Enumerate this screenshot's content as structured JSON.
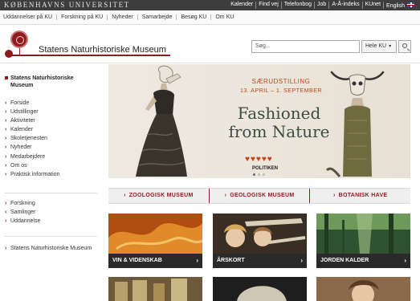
{
  "topbar": {
    "brand": "KØBENHAVNS UNIVERSITET",
    "links": [
      "Kalender",
      "Find vej",
      "Telefonbog",
      "Job",
      "A-Å-indeks",
      "KUnet",
      "English"
    ]
  },
  "subnav": {
    "items": [
      "Uddannelser på KU",
      "Forskning på KU",
      "Nyheder",
      "Samarbejde",
      "Besøg KU",
      "Om KU"
    ]
  },
  "header": {
    "site_title": "Statens Naturhistoriske Museum"
  },
  "search": {
    "placeholder": "Søg...",
    "scope": "Hele KU"
  },
  "sidebar": {
    "heading": "Statens Naturhistoriske Museum",
    "group1": [
      "Forside",
      "Udstillinger",
      "Aktiviteter",
      "Kalender",
      "Skoletjenesten",
      "Nyheder",
      "Medarbejdere",
      "Om os",
      "Praktisk information"
    ],
    "group2": [
      "Forskning",
      "Samlinger",
      "Uddannelse"
    ],
    "group3": [
      "Statens Naturhistoriske Museum"
    ]
  },
  "hero": {
    "kicker": "SÆRUDSTILLING",
    "dates": "13. APRIL – 1. SEPTEMBER",
    "headline_line1": "Fashioned",
    "headline_line2": "from Nature",
    "hearts": "♥♥♥♥♥",
    "publisher": "POLITIKEN"
  },
  "categories": [
    "ZOOLOGISK MUSEUM",
    "GEOLOGISK MUSEUM",
    "BOTANISK HAVE"
  ],
  "tiles": [
    {
      "caption": "VIN & VIDENSKAB",
      "color": "#c7661a"
    },
    {
      "caption": "ÅRSKORT",
      "color": "#5a4a3a"
    },
    {
      "caption": "JORDEN KALDER",
      "color": "#3f6a3a"
    }
  ],
  "colors": {
    "accent": "#901a1e",
    "topbar": "#3d3d3d",
    "hero_text": "#b8481f"
  }
}
